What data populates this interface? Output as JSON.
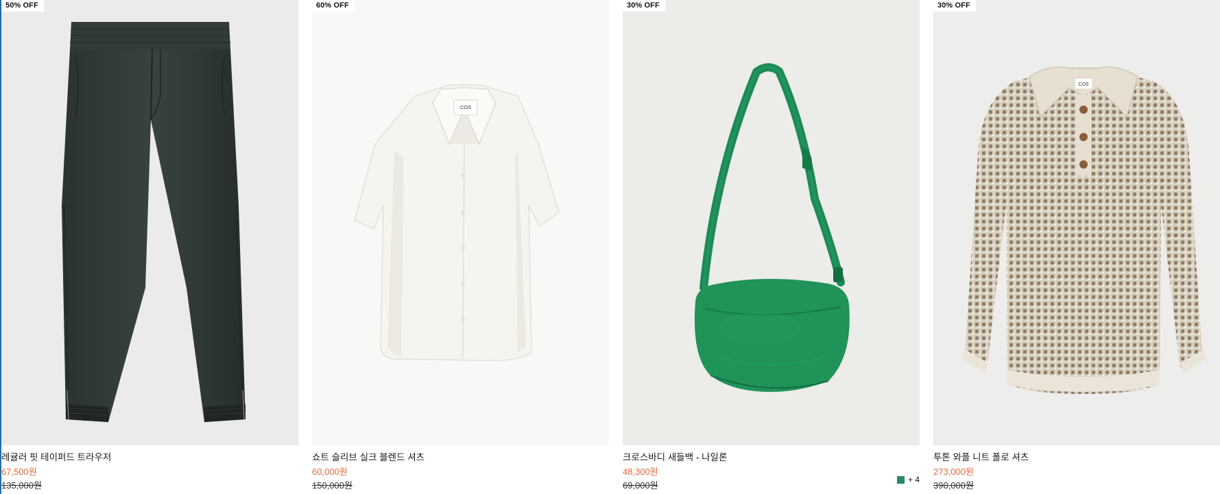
{
  "products": [
    {
      "badge": "50% OFF",
      "name": "레귤러 핏 테이퍼드 트라우저",
      "sale_price": "67,500원",
      "original_price": "135,000원",
      "image": "dark-green-tapered-trousers"
    },
    {
      "badge": "60% OFF",
      "name": "쇼트 슬리브 실크 블렌드 셔츠",
      "sale_price": "60,000원",
      "original_price": "150,000원",
      "image": "white-short-sleeve-shirt"
    },
    {
      "badge": "30% OFF",
      "name": "크로스바디 새들백 - 나일론",
      "sale_price": "48,300원",
      "original_price": "69,000원",
      "image": "green-nylon-crossbody-bag",
      "swatch_color": "#2a8a62",
      "more_colors": "+ 4"
    },
    {
      "badge": "30% OFF",
      "name": "투톤 와플 니트 폴로 셔츠",
      "sale_price": "273,000원",
      "original_price": "390,000원",
      "image": "beige-waffle-knit-polo"
    }
  ],
  "garment_labels": {
    "shirt": "COS",
    "polo": "COS"
  },
  "colors": {
    "sale_price": "#e46a3d",
    "edge_accent": "#1f6ea8"
  }
}
